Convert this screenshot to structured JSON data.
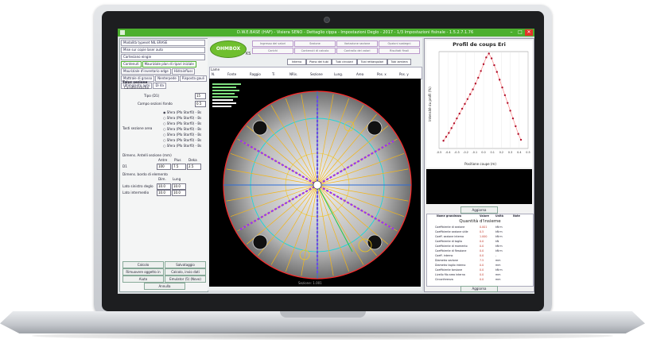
{
  "window": {
    "title": "D.W.E.BASE (HAF) - Visiera SENO - Dettaglio cippa - Impostazioni Deglo - 2017 - 1/3 Impostazioni fisinale - 1.5.2.7.1.76",
    "minimize": "–",
    "maximize": "□",
    "close": "✕"
  },
  "left_panel": {
    "tabs": [
      "Modalità typeset NIL ERASE",
      "Mise sur copie laser auto",
      "Cartesiano eingie",
      "Contenuti",
      "Mauriziale plan di ripari iniziale",
      "Mauriziale d'inventario edge",
      "Hidrainfluss",
      "Mattrale di grasso",
      "Nenterpede",
      "Risposta gauli",
      "Ultimolanto auto",
      "Di da"
    ],
    "section_title": "Taluz sezione",
    "subsection": "Caratteristiche",
    "fields": [
      {
        "label": "Tipo (D1)",
        "value": "15"
      },
      {
        "label": "Campo sezioni fondo",
        "value": "0.5"
      }
    ],
    "radio_group_label": "Tasti sezione area",
    "radios": [
      "Sfera (Pfo Storf0) - Bs",
      "Sfera (Pfo Storf0) - Bs",
      "Sfera (Pfo Storf0) - Bs",
      "Sfera (Pfo Storf0) - Bs",
      "Sfera (Pfo Storf0) - Bs",
      "Sfera (Pfo Storf0) - Bs",
      "Sfera (Pfo Storf0) - Bs"
    ],
    "dims_section": "Dimens. Antelli sezione (mm)",
    "dims_headers": [
      "Antre",
      "Plus",
      "Deka"
    ],
    "dims_row": {
      "label": "D1",
      "values": [
        "100",
        "7.5",
        "2.5"
      ]
    },
    "mesh_section": "Dimens. bordo di elemento",
    "mesh_headers": [
      "Dim.",
      "Lung"
    ],
    "mesh_rows": [
      {
        "label": "Lato sinistro deglo",
        "values": [
          "10.0",
          "10.0"
        ]
      },
      {
        "label": "Lato intermedio",
        "values": [
          "10.0",
          "10.0"
        ]
      }
    ],
    "buttons": [
      "Calcolo",
      "Salvataggio",
      "Rimuovere oggetto in base",
      "Calcolo, invio dati",
      "Aiuto",
      "Emulator (5) (Novo)",
      "Annulla"
    ]
  },
  "center_panel": {
    "brand": "OHMBOX",
    "brand_sub": "KS",
    "top_cells": [
      "Ingresso dei valori",
      "Sezione",
      "Variazione sezione",
      "Opzioni sostegni",
      "Carichi",
      "Contenuti di calcolo",
      "Controllo dei valori",
      "Risultati finali"
    ],
    "view_tabs": [
      "Interno",
      "Piano dei tubi",
      "Tubi circolari",
      "Tubi rettangolari",
      "Tubi lamiera"
    ],
    "header_label": "Lame",
    "table_cols": [
      "N.",
      "Fonte",
      "Raggio",
      "Ti",
      "NRis.",
      "Sezione",
      "Lung.",
      "Area",
      "Pos. x",
      "Pos. y"
    ],
    "plot_caption": "Sezione: 1.001"
  },
  "right_panel": {
    "chart_button": "Aggiorna",
    "table_title": "Quantità d'insieme",
    "table_headers": [
      "Nome grandezza",
      "Valore",
      "Unità",
      "Note"
    ],
    "table_rows": [
      {
        "name": "Coefficiente di sezione",
        "value": "0.001",
        "unit": "kN·m"
      },
      {
        "name": "Coefficiente sezione utile",
        "value": "0.5",
        "unit": "kN·m"
      },
      {
        "name": "Coeff. sezione interna",
        "value": "1.000",
        "unit": "kN·m"
      },
      {
        "name": "Coefficiente di taglio",
        "value": "0.0",
        "unit": "kN"
      },
      {
        "name": "Coefficiente di momento",
        "value": "0.0",
        "unit": "kN·m"
      },
      {
        "name": "Coefficiente di flessione",
        "value": "0.0",
        "unit": "kN·m"
      },
      {
        "name": "Coeff. interno",
        "value": "0.0",
        "unit": "-"
      },
      {
        "name": "Diametro sezione",
        "value": "7.5",
        "unit": "mm"
      },
      {
        "name": "Diametro taglio interno",
        "value": "0.0",
        "unit": "mm"
      },
      {
        "name": "Coefficiente torsione",
        "value": "0.0",
        "unit": "kN·m"
      },
      {
        "name": "Livello filo area interna",
        "value": "0.0",
        "unit": "mm"
      },
      {
        "name": "Circonferenza",
        "value": "0.0",
        "unit": "mm"
      }
    ],
    "bottom_button": "Aggiorna"
  },
  "chart_data": {
    "type": "scatter",
    "title": "Profil de coups Eri",
    "xlabel": "Positione coupe (m)",
    "ylabel": "Intensité du profil (%)",
    "xlim": [
      -0.5,
      0.5
    ],
    "ylim": [
      0,
      100
    ],
    "x_ticks": [
      "-0.5",
      "-0.4",
      "-0.3",
      "-0.2",
      "-0.1",
      "0.0",
      "0.1",
      "0.2",
      "0.3",
      "0.4",
      "0.5"
    ],
    "series": [
      {
        "x": [
          -0.45,
          -0.42,
          -0.39,
          -0.36,
          -0.33,
          -0.3,
          -0.27,
          -0.24,
          -0.21,
          -0.18,
          -0.15,
          -0.12,
          -0.09,
          -0.06,
          -0.03,
          0.0,
          0.03,
          0.06,
          0.09,
          0.12,
          0.15,
          0.18,
          0.21,
          0.24,
          0.27,
          0.3,
          0.33,
          0.36,
          0.39,
          0.42
        ],
        "y": [
          8,
          12,
          16,
          21,
          26,
          31,
          36,
          41,
          46,
          51,
          56,
          61,
          67,
          73,
          80,
          87,
          94,
          98,
          93,
          86,
          79,
          71,
          63,
          55,
          47,
          39,
          31,
          23,
          15,
          9
        ]
      }
    ],
    "colors": {
      "points": "#b0102a",
      "line": "#ff8a8a"
    }
  }
}
